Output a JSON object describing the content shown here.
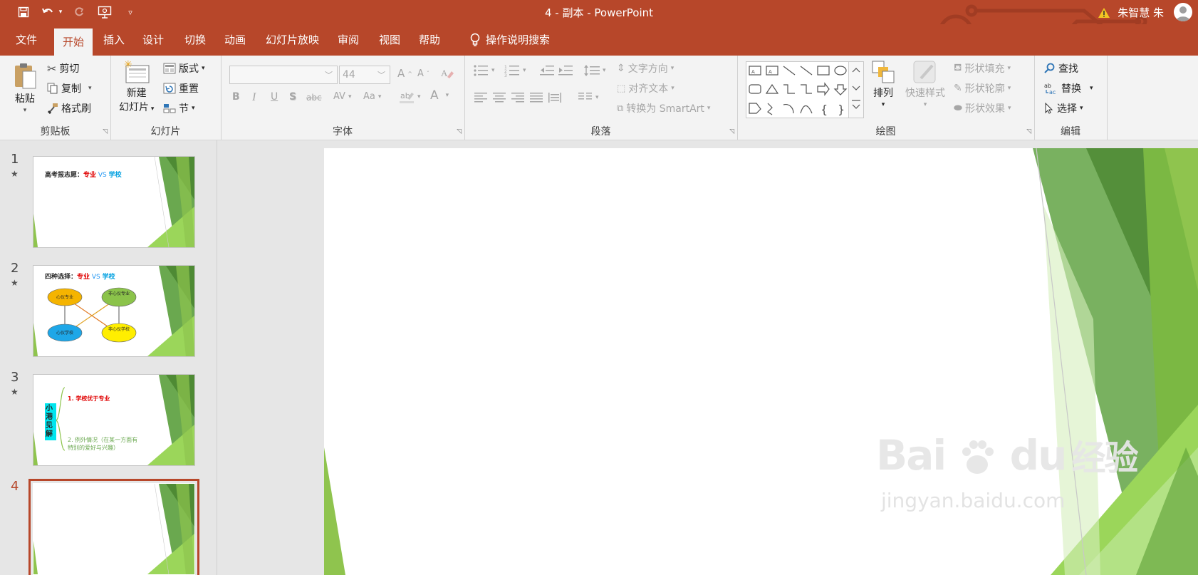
{
  "window": {
    "title": "4 - 副本  -  PowerPoint",
    "user_name": "朱智慧 朱",
    "accent": "#b7472a"
  },
  "menu": {
    "items": [
      "文件",
      "开始",
      "插入",
      "设计",
      "切换",
      "动画",
      "幻灯片放映",
      "审阅",
      "视图",
      "帮助"
    ],
    "active": "开始",
    "tell_me": "操作说明搜索"
  },
  "ribbon": {
    "clipboard": {
      "paste": "粘贴",
      "cut": "剪切",
      "copy": "复制",
      "format_painter": "格式刷",
      "label": "剪贴板"
    },
    "slides": {
      "new_slide_line1": "新建",
      "new_slide_line2": "幻灯片",
      "layout": "版式",
      "reset": "重置",
      "section": "节",
      "label": "幻灯片"
    },
    "font": {
      "font_name": "",
      "font_size": "44",
      "bold": "B",
      "italic": "I",
      "underline": "U",
      "shadow": "S",
      "strike": "abc",
      "spacing": "AV",
      "case": "Aa",
      "grow": "A",
      "shrink": "A",
      "color": "A",
      "label": "字体"
    },
    "paragraph": {
      "text_direction": "文字方向",
      "align_text": "对齐文本",
      "smartart": "转换为 SmartArt",
      "label": "段落"
    },
    "drawing": {
      "arrange": "排列",
      "quick_styles": "快速样式",
      "shape_fill": "形状填充",
      "shape_outline": "形状轮廓",
      "shape_effects": "形状效果",
      "label": "绘图"
    },
    "editing": {
      "find": "查找",
      "replace": "替换",
      "select": "选择",
      "label": "编辑"
    }
  },
  "slides": [
    {
      "number": "1",
      "star": "★",
      "title_black": "高考报志愿：",
      "title_red": "专业",
      "title_vs": " VS ",
      "title_blue": "学校"
    },
    {
      "number": "2",
      "star": "★",
      "title_black": "四种选择：",
      "title_red": "专业",
      "title_vs": " VS ",
      "title_blue": "学校",
      "nodes": [
        "心仪专业",
        "非心仪专业",
        "心仪学校",
        "非心仪学校"
      ]
    },
    {
      "number": "3",
      "star": "★",
      "side_label": "小港见解",
      "point1": "1. 学校优于专业",
      "point2_line1": "2. 例外情况（在某一方面有",
      "point2_line2": "特别的爱好与兴趣）"
    },
    {
      "number": "4",
      "selected": true
    }
  ],
  "watermark": {
    "brand": "Bai",
    "brand2": "du",
    "cn": "经验",
    "url": "jingyan.baidu.com"
  }
}
